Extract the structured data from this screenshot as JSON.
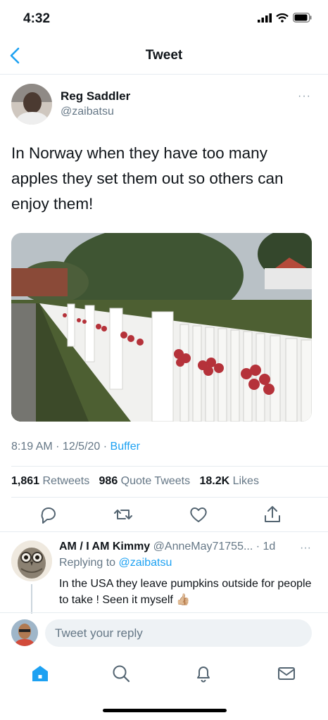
{
  "status_bar": {
    "time": "4:32"
  },
  "nav": {
    "title": "Tweet"
  },
  "tweet": {
    "author_name": "Reg Saddler",
    "author_handle": "@zaibatsu",
    "text": "In Norway when they have too many apples they set them out so others can enjoy them!",
    "time_date": "8:19 AM · 12/5/20 · ",
    "source": "Buffer",
    "retweets_count": "1,861",
    "retweets_label": " Retweets",
    "quotes_count": "986",
    "quotes_label": " Quote Tweets",
    "likes_count": "18.2K",
    "likes_label": " Likes",
    "more_glyph": "···"
  },
  "reply": {
    "name": "AM / I AM Kimmy",
    "handle": " @AnneMay71755... · 1d",
    "replying_label": "Replying to ",
    "replying_to": "@zaibatsu",
    "text": "In the USA they leave pumpkins outside for people to take !  Seen it myself 👍🏼",
    "more_glyph": "···"
  },
  "composer": {
    "placeholder": "Tweet your reply"
  },
  "colors": {
    "accent": "#1da1f2",
    "muted": "#657786",
    "text": "#0f1419"
  },
  "icons": [
    "chevron-left-icon",
    "reply-icon",
    "retweet-icon",
    "heart-icon",
    "share-icon",
    "home-icon",
    "search-icon",
    "notifications-icon",
    "messages-icon"
  ]
}
